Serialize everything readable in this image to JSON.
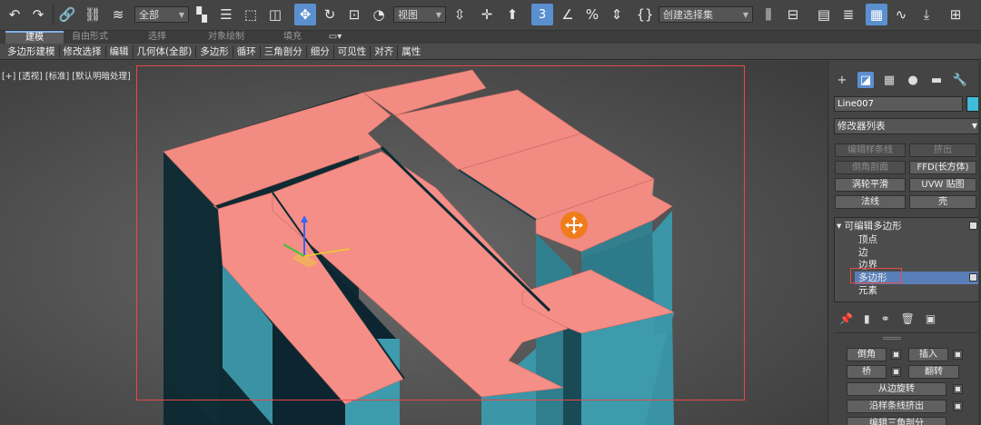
{
  "toolbar": {
    "selection_filter": "全部",
    "reference_coord": "视图",
    "named_selection": "创建选择集"
  },
  "ribbon": {
    "tabs": [
      "建模",
      "自由形式",
      "选择",
      "对象绘制",
      "填充"
    ],
    "active_tab": "建模",
    "tools": [
      "多边形建模",
      "修改选择",
      "编辑",
      "几何体(全部)",
      "多边形",
      "循环",
      "三角剖分",
      "细分",
      "可见性",
      "对齐",
      "属性"
    ]
  },
  "viewport": {
    "label": "[+] [透视] [标准] [默认明暗处理]"
  },
  "command_panel": {
    "object_name": "Line007",
    "object_color": "#3fbcd8",
    "modifier_list": "修改器列表",
    "modifier_buttons": [
      {
        "label": "编辑样条线",
        "enabled": false
      },
      {
        "label": "挤出",
        "enabled": false
      },
      {
        "label": "倒角剖面",
        "enabled": false
      },
      {
        "label": "FFD(长方体)",
        "enabled": true
      },
      {
        "label": "涡轮平滑",
        "enabled": true
      },
      {
        "label": "UVW 贴图",
        "enabled": true
      },
      {
        "label": "法线",
        "enabled": true
      },
      {
        "label": "壳",
        "enabled": true
      }
    ],
    "stack": {
      "root": "可编辑多边形",
      "items": [
        "顶点",
        "边",
        "边界",
        "多边形",
        "元素"
      ],
      "selected": "多边形"
    },
    "edit_polygons": {
      "bevel": "倒角",
      "insert": "插入",
      "bridge": "桥",
      "flip": "翻转",
      "hinge_from_edge": "从边旋转",
      "extrude_along_spline": "沿样条线挤出",
      "edit_triangulation": "编辑三角剖分"
    }
  }
}
